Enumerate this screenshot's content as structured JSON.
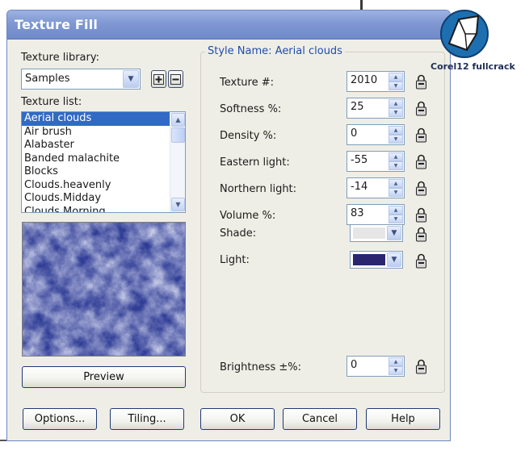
{
  "dialog": {
    "title": "Texture Fill"
  },
  "library": {
    "label": "Texture library:",
    "selected": "Samples"
  },
  "texture_list": {
    "label": "Texture list:",
    "items": [
      "Aerial clouds",
      "Air brush",
      "Alabaster",
      "Banded malachite",
      "Blocks",
      "Clouds.heavenly",
      "Clouds.Midday",
      "Clouds.Morning"
    ],
    "selected_index": 0
  },
  "preview_button": "Preview",
  "style_group": {
    "title": "Style Name: Aerial clouds"
  },
  "params": [
    {
      "label": "Texture #:",
      "value": "2010"
    },
    {
      "label": "Softness %:",
      "value": "25"
    },
    {
      "label": "Density %:",
      "value": "0"
    },
    {
      "label": "Eastern light:",
      "value": "-55"
    },
    {
      "label": "Northern light:",
      "value": "-14"
    },
    {
      "label": "Volume %:",
      "value": "83"
    }
  ],
  "shade": {
    "label": "Shade:",
    "color": "#e6e6e6"
  },
  "light": {
    "label": "Light:",
    "color": "#2b2570"
  },
  "brightness": {
    "label": "Brightness ±%:",
    "value": "0"
  },
  "buttons": {
    "options": "Options...",
    "tiling": "Tiling...",
    "ok": "OK",
    "cancel": "Cancel",
    "help": "Help"
  },
  "watermark": {
    "brand": "Corel",
    "version": "12",
    "suffix": "fullcrack"
  },
  "colors": {
    "titlebar": "#7f98d3",
    "selection": "#316ac5",
    "group_title": "#1f4ea8",
    "texture_dark": "#2d3b94",
    "texture_light": "#d4d8ee"
  }
}
